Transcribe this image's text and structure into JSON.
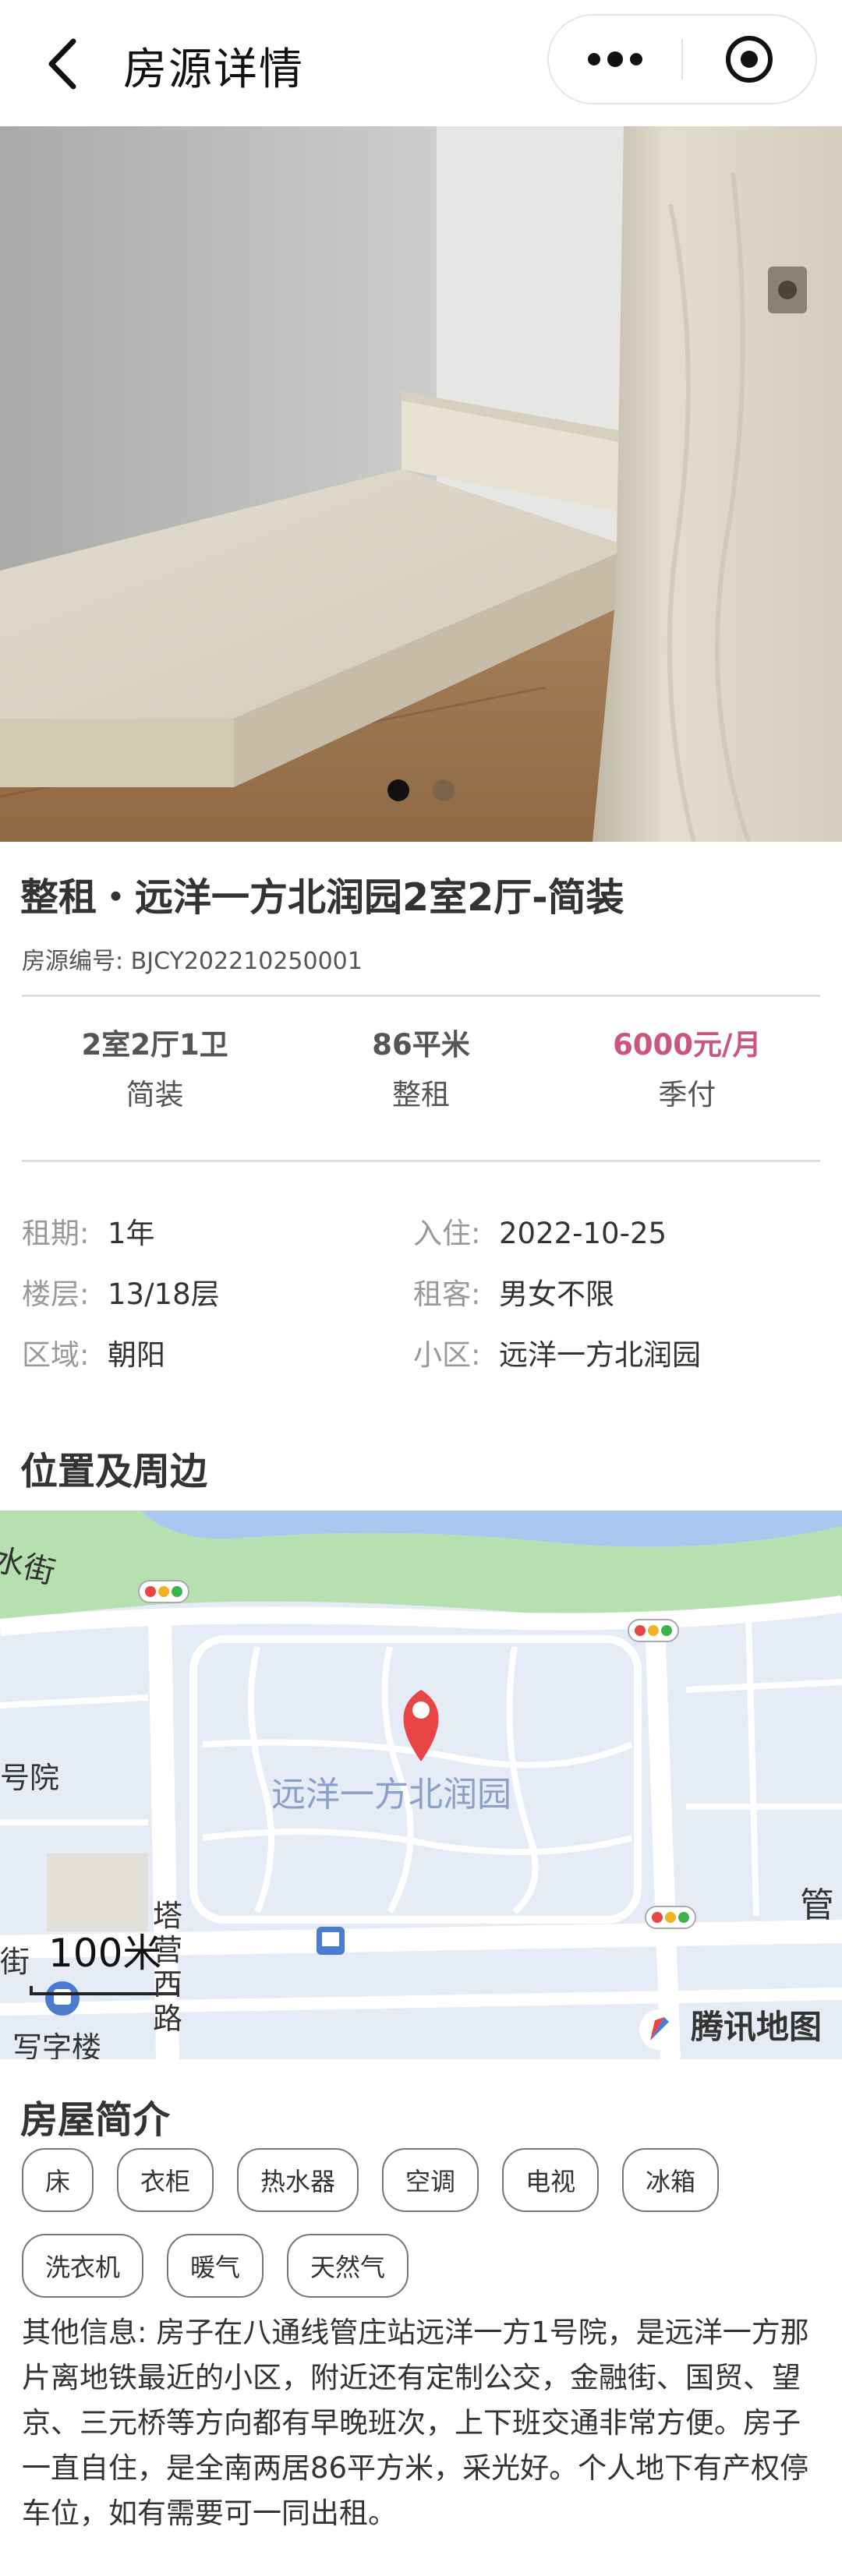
{
  "nav": {
    "title": "房源详情",
    "back_icon": "chevron-left-icon",
    "more_icon": "more-dots-icon",
    "close_icon": "target-circle-icon"
  },
  "gallery": {
    "image_count": 2,
    "active_index": 0
  },
  "listing": {
    "title": "整租・远洋一方北润园2室2厅-简装",
    "code": "房源编号: BJCY202210250001"
  },
  "stats": [
    {
      "main": "2室2厅1卫",
      "sub": "简装"
    },
    {
      "main": "86平米",
      "sub": "整租"
    },
    {
      "main": "6000元/月",
      "sub": "季付"
    }
  ],
  "details": [
    {
      "label": "租期:",
      "value": "1年"
    },
    {
      "label": "入住:",
      "value": "2022-10-25"
    },
    {
      "label": "楼层:",
      "value": "13/18层"
    },
    {
      "label": "租客:",
      "value": "男女不限"
    },
    {
      "label": "区域:",
      "value": "朝阳"
    },
    {
      "label": "小区:",
      "value": "远洋一方北润园"
    }
  ],
  "location": {
    "heading": "位置及周边",
    "map": {
      "place_label": "远洋一方北润园",
      "labels": [
        "水街",
        "号院",
        "塔营西路",
        "写字楼",
        "管",
        "街"
      ],
      "scale": "100米",
      "provider": "腾讯地图"
    }
  },
  "intro": {
    "heading": "房屋简介",
    "tags": [
      "床",
      "衣柜",
      "热水器",
      "空调",
      "电视",
      "冰箱",
      "洗衣机",
      "暖气",
      "天然气"
    ],
    "description": "其他信息: 房子在八通线管庄站远洋一方1号院，是远洋一方那片离地铁最近的小区，附近还有定制公交，金融街、国贸、望京、三元桥等方向都有早晚班次，上下班交通非常方便。房子一直自住，是全南两居86平方米，采光好。个人地下有产权停车位，如有需要可一同出租。"
  },
  "colors": {
    "price": "#c9577a",
    "map_water": "#a9c8f0",
    "map_green": "#b7e0b0",
    "map_pin": "#e84545"
  }
}
